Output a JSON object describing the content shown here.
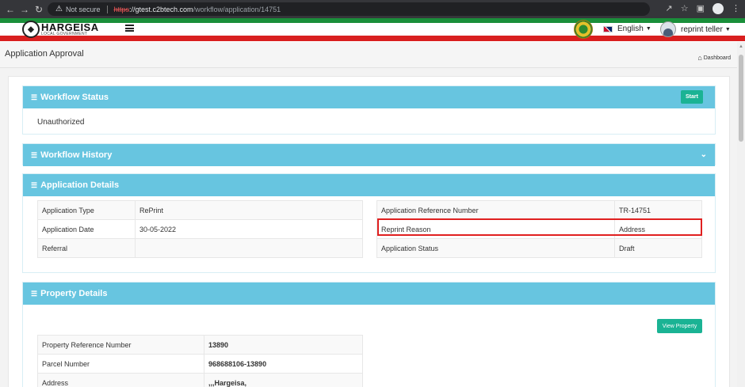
{
  "browser": {
    "security_label": "Not secure",
    "url_scheme": "https",
    "url_host": "://gtest.c2btech.com",
    "url_path": "/workflow/application/14751"
  },
  "header": {
    "logo_title": "HARGEISA",
    "logo_subtitle": "LOCAL GOVERNMENT",
    "language": "English",
    "user_name": "reprint teller",
    "accent_green": "#1a8f3a",
    "accent_red": "#d91f1f"
  },
  "page": {
    "title": "Application Approval",
    "breadcrumb": "Dashboard"
  },
  "workflow_status": {
    "heading": "Workflow Status",
    "start_label": "Start",
    "status": "Unauthorized"
  },
  "workflow_history": {
    "heading": "Workflow History"
  },
  "application_details": {
    "heading": "Application Details",
    "left_rows": [
      {
        "label": "Application Type",
        "value": "RePrint"
      },
      {
        "label": "Application Date",
        "value": "30-05-2022"
      },
      {
        "label": "Referral",
        "value": ""
      }
    ],
    "right_rows": [
      {
        "label": "Application Reference Number",
        "value": "TR-14751"
      },
      {
        "label": "Reprint Reason",
        "value": "Address"
      },
      {
        "label": "Application Status",
        "value": "Draft"
      }
    ]
  },
  "property_details": {
    "heading": "Property Details",
    "view_label": "View Property",
    "rows": [
      {
        "label": "Property Reference Number",
        "value": "13890"
      },
      {
        "label": "Parcel Number",
        "value": "968688106-13890"
      },
      {
        "label": "Address",
        "value": ",,,Hargeisa,"
      }
    ]
  },
  "panel_color": "#67c5e0",
  "button_color": "#1ab394",
  "highlight_color": "#e02020"
}
